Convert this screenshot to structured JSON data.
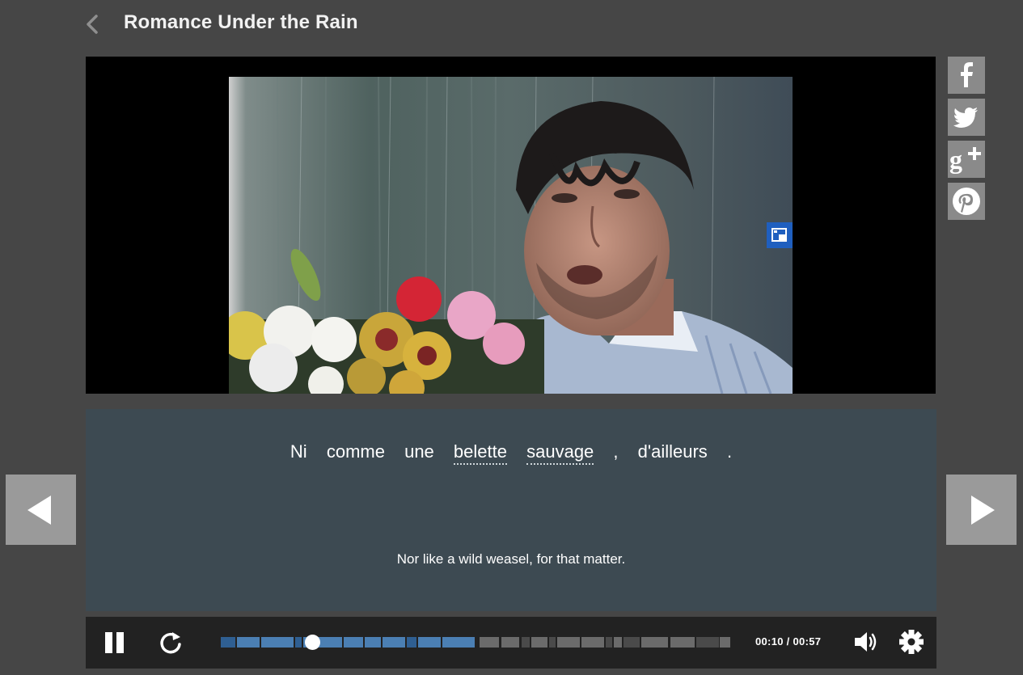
{
  "header": {
    "title": "Romance Under the Rain"
  },
  "subtitles": {
    "french_words": [
      "Ni",
      "comme",
      "une",
      "belette",
      "sauvage",
      ",",
      "d'ailleurs",
      "."
    ],
    "underlined_words": [
      "belette",
      "sauvage"
    ],
    "english": "Nor like a wild weasel, for that matter."
  },
  "player": {
    "current_time": "00:10",
    "separator": "/",
    "duration": "00:57",
    "progress_fraction": 0.18,
    "accent_color": "#4b7fb3"
  },
  "social": [
    "facebook-icon",
    "twitter-icon",
    "google-plus-icon",
    "pinterest-icon"
  ],
  "colors": {
    "background": "#464646",
    "subtitle_panel": "#3d4a52",
    "control_bar": "#222222",
    "pip_button": "#1f5fbf"
  }
}
